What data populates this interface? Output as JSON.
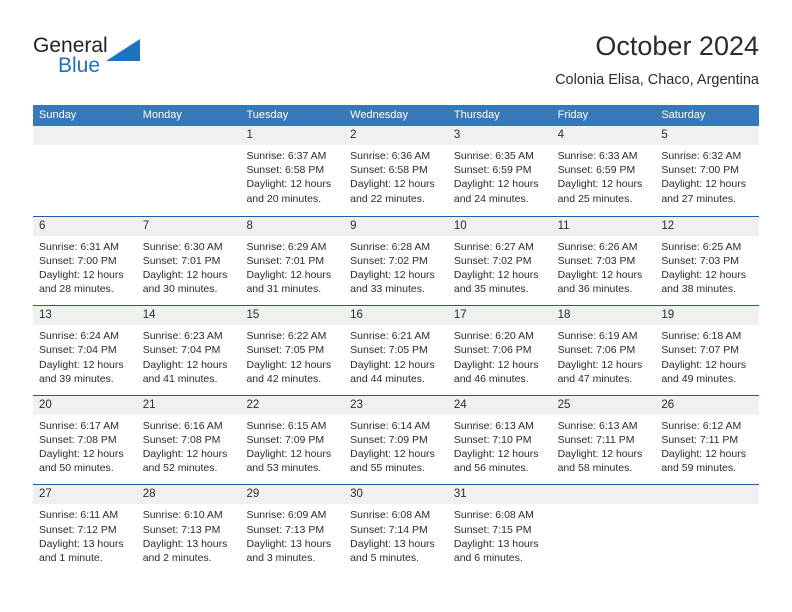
{
  "brand": {
    "name_part1": "General",
    "name_part2": "Blue",
    "logo_icon": "triangle-logo-icon",
    "accent_color": "#1e73be"
  },
  "header": {
    "title": "October 2024",
    "subtitle": "Colonia Elisa, Chaco, Argentina"
  },
  "calendar": {
    "header_bg": "#3679b6",
    "row_divider": "#1f5fa0",
    "daynum_bg": "#f0f0f0",
    "weekdays": [
      "Sunday",
      "Monday",
      "Tuesday",
      "Wednesday",
      "Thursday",
      "Friday",
      "Saturday"
    ],
    "weeks": [
      [
        {
          "day": "",
          "lines": []
        },
        {
          "day": "",
          "lines": []
        },
        {
          "day": "1",
          "lines": [
            "Sunrise: 6:37 AM",
            "Sunset: 6:58 PM",
            "Daylight: 12 hours and 20 minutes."
          ]
        },
        {
          "day": "2",
          "lines": [
            "Sunrise: 6:36 AM",
            "Sunset: 6:58 PM",
            "Daylight: 12 hours and 22 minutes."
          ]
        },
        {
          "day": "3",
          "lines": [
            "Sunrise: 6:35 AM",
            "Sunset: 6:59 PM",
            "Daylight: 12 hours and 24 minutes."
          ]
        },
        {
          "day": "4",
          "lines": [
            "Sunrise: 6:33 AM",
            "Sunset: 6:59 PM",
            "Daylight: 12 hours and 25 minutes."
          ]
        },
        {
          "day": "5",
          "lines": [
            "Sunrise: 6:32 AM",
            "Sunset: 7:00 PM",
            "Daylight: 12 hours and 27 minutes."
          ]
        }
      ],
      [
        {
          "day": "6",
          "lines": [
            "Sunrise: 6:31 AM",
            "Sunset: 7:00 PM",
            "Daylight: 12 hours and 28 minutes."
          ]
        },
        {
          "day": "7",
          "lines": [
            "Sunrise: 6:30 AM",
            "Sunset: 7:01 PM",
            "Daylight: 12 hours and 30 minutes."
          ]
        },
        {
          "day": "8",
          "lines": [
            "Sunrise: 6:29 AM",
            "Sunset: 7:01 PM",
            "Daylight: 12 hours and 31 minutes."
          ]
        },
        {
          "day": "9",
          "lines": [
            "Sunrise: 6:28 AM",
            "Sunset: 7:02 PM",
            "Daylight: 12 hours and 33 minutes."
          ]
        },
        {
          "day": "10",
          "lines": [
            "Sunrise: 6:27 AM",
            "Sunset: 7:02 PM",
            "Daylight: 12 hours and 35 minutes."
          ]
        },
        {
          "day": "11",
          "lines": [
            "Sunrise: 6:26 AM",
            "Sunset: 7:03 PM",
            "Daylight: 12 hours and 36 minutes."
          ]
        },
        {
          "day": "12",
          "lines": [
            "Sunrise: 6:25 AM",
            "Sunset: 7:03 PM",
            "Daylight: 12 hours and 38 minutes."
          ]
        }
      ],
      [
        {
          "day": "13",
          "lines": [
            "Sunrise: 6:24 AM",
            "Sunset: 7:04 PM",
            "Daylight: 12 hours and 39 minutes."
          ]
        },
        {
          "day": "14",
          "lines": [
            "Sunrise: 6:23 AM",
            "Sunset: 7:04 PM",
            "Daylight: 12 hours and 41 minutes."
          ]
        },
        {
          "day": "15",
          "lines": [
            "Sunrise: 6:22 AM",
            "Sunset: 7:05 PM",
            "Daylight: 12 hours and 42 minutes."
          ]
        },
        {
          "day": "16",
          "lines": [
            "Sunrise: 6:21 AM",
            "Sunset: 7:05 PM",
            "Daylight: 12 hours and 44 minutes."
          ]
        },
        {
          "day": "17",
          "lines": [
            "Sunrise: 6:20 AM",
            "Sunset: 7:06 PM",
            "Daylight: 12 hours and 46 minutes."
          ]
        },
        {
          "day": "18",
          "lines": [
            "Sunrise: 6:19 AM",
            "Sunset: 7:06 PM",
            "Daylight: 12 hours and 47 minutes."
          ]
        },
        {
          "day": "19",
          "lines": [
            "Sunrise: 6:18 AM",
            "Sunset: 7:07 PM",
            "Daylight: 12 hours and 49 minutes."
          ]
        }
      ],
      [
        {
          "day": "20",
          "lines": [
            "Sunrise: 6:17 AM",
            "Sunset: 7:08 PM",
            "Daylight: 12 hours and 50 minutes."
          ]
        },
        {
          "day": "21",
          "lines": [
            "Sunrise: 6:16 AM",
            "Sunset: 7:08 PM",
            "Daylight: 12 hours and 52 minutes."
          ]
        },
        {
          "day": "22",
          "lines": [
            "Sunrise: 6:15 AM",
            "Sunset: 7:09 PM",
            "Daylight: 12 hours and 53 minutes."
          ]
        },
        {
          "day": "23",
          "lines": [
            "Sunrise: 6:14 AM",
            "Sunset: 7:09 PM",
            "Daylight: 12 hours and 55 minutes."
          ]
        },
        {
          "day": "24",
          "lines": [
            "Sunrise: 6:13 AM",
            "Sunset: 7:10 PM",
            "Daylight: 12 hours and 56 minutes."
          ]
        },
        {
          "day": "25",
          "lines": [
            "Sunrise: 6:13 AM",
            "Sunset: 7:11 PM",
            "Daylight: 12 hours and 58 minutes."
          ]
        },
        {
          "day": "26",
          "lines": [
            "Sunrise: 6:12 AM",
            "Sunset: 7:11 PM",
            "Daylight: 12 hours and 59 minutes."
          ]
        }
      ],
      [
        {
          "day": "27",
          "lines": [
            "Sunrise: 6:11 AM",
            "Sunset: 7:12 PM",
            "Daylight: 13 hours and 1 minute."
          ]
        },
        {
          "day": "28",
          "lines": [
            "Sunrise: 6:10 AM",
            "Sunset: 7:13 PM",
            "Daylight: 13 hours and 2 minutes."
          ]
        },
        {
          "day": "29",
          "lines": [
            "Sunrise: 6:09 AM",
            "Sunset: 7:13 PM",
            "Daylight: 13 hours and 3 minutes."
          ]
        },
        {
          "day": "30",
          "lines": [
            "Sunrise: 6:08 AM",
            "Sunset: 7:14 PM",
            "Daylight: 13 hours and 5 minutes."
          ]
        },
        {
          "day": "31",
          "lines": [
            "Sunrise: 6:08 AM",
            "Sunset: 7:15 PM",
            "Daylight: 13 hours and 6 minutes."
          ]
        },
        {
          "day": "",
          "lines": []
        },
        {
          "day": "",
          "lines": []
        }
      ]
    ]
  }
}
